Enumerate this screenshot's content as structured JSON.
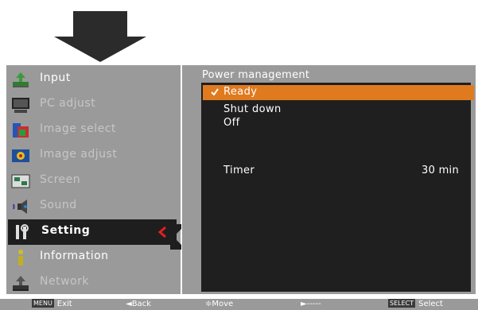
{
  "menu": {
    "items": [
      {
        "label": "Input",
        "state": "enabled",
        "icon": "input-icon"
      },
      {
        "label": "PC adjust",
        "state": "disabled",
        "icon": "pc-adjust-icon"
      },
      {
        "label": "Image select",
        "state": "disabled",
        "icon": "image-select-icon"
      },
      {
        "label": "Image adjust",
        "state": "disabled",
        "icon": "image-adjust-icon"
      },
      {
        "label": "Screen",
        "state": "disabled",
        "icon": "screen-icon"
      },
      {
        "label": "Sound",
        "state": "disabled",
        "icon": "sound-icon"
      },
      {
        "label": "Setting",
        "state": "selected",
        "icon": "setting-icon"
      },
      {
        "label": "Information",
        "state": "enabled",
        "icon": "information-icon"
      },
      {
        "label": "Network",
        "state": "disabled",
        "icon": "network-icon"
      }
    ]
  },
  "submenu": {
    "title": "Power management",
    "options": [
      {
        "label": "Ready",
        "selected": true
      },
      {
        "label": "Shut down",
        "selected": false
      },
      {
        "label": "Off",
        "selected": false
      }
    ],
    "timer_label": "Timer",
    "timer_value": "30 min"
  },
  "helpbar": {
    "exit_key": "MENU",
    "exit_label": "Exit",
    "back_label": "◄Back",
    "move_label": "≑Move",
    "next_label": "►-----",
    "select_key": "SELECT",
    "select_label": "Select"
  },
  "colors": {
    "panel": "#9a9a9a",
    "inner": "#1f1f1f",
    "highlight": "#e07a1f",
    "caret": "#e02020"
  }
}
